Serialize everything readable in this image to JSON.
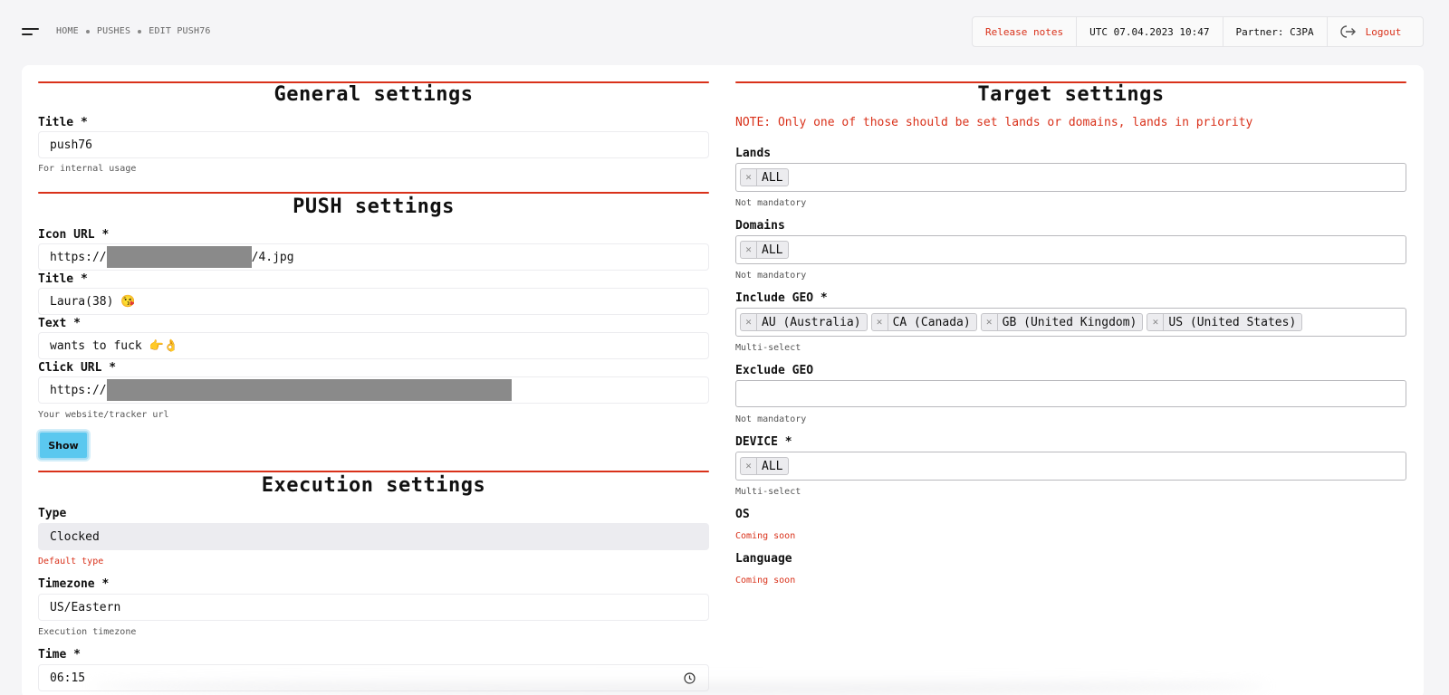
{
  "header": {
    "breadcrumb": [
      "HOME",
      "PUSHES",
      "EDIT PUSH76"
    ],
    "release_notes": "Release notes",
    "datetime": "UTC 07.04.2023 10:47",
    "partner": "Partner: C3PA",
    "logout": "Logout"
  },
  "general": {
    "title": "General settings",
    "title_label": "Title *",
    "title_value": "push76",
    "title_hint": "For internal usage"
  },
  "push": {
    "title": "PUSH settings",
    "icon_url_label": "Icon URL *",
    "icon_url_prefix": "https://",
    "icon_url_suffix": "/4.jpg",
    "title_label": "Title *",
    "title_value": "Laura(38) 😘",
    "text_label": "Text *",
    "text_value": "wants to fuck 👉👌",
    "click_url_label": "Click URL *",
    "click_url_prefix": "https://",
    "click_url_hint": "Your website/tracker url",
    "show_button": "Show"
  },
  "execution": {
    "title": "Execution settings",
    "type_label": "Type",
    "type_value": "Clocked",
    "type_hint": "Default type",
    "timezone_label": "Timezone *",
    "timezone_value": "US/Eastern",
    "timezone_hint": "Execution timezone",
    "time_label": "Time *",
    "time_value": "06:15"
  },
  "target": {
    "title": "Target settings",
    "note": "NOTE: Only one of those should be set lands or domains, lands in priority",
    "lands_label": "Lands",
    "lands_tags": [
      "ALL"
    ],
    "lands_hint": "Not mandatory",
    "domains_label": "Domains",
    "domains_tags": [
      "ALL"
    ],
    "domains_hint": "Not mandatory",
    "include_geo_label": "Include GEO *",
    "include_geo_tags": [
      "AU (Australia)",
      "CA (Canada)",
      "GB (United Kingdom)",
      "US (United States)"
    ],
    "include_geo_hint": "Multi-select",
    "exclude_geo_label": "Exclude GEO",
    "exclude_geo_hint": "Not mandatory",
    "device_label": "DEVICE *",
    "device_tags": [
      "ALL"
    ],
    "device_hint": "Multi-select",
    "os_label": "OS",
    "os_hint": "Coming soon",
    "language_label": "Language",
    "language_hint": "Coming soon"
  },
  "colors": {
    "accent": "#d9311a",
    "button": "#5bc8ef"
  },
  "icons": [
    "menu-icon",
    "logout-icon",
    "clock-icon",
    "remove-tag-icon"
  ]
}
